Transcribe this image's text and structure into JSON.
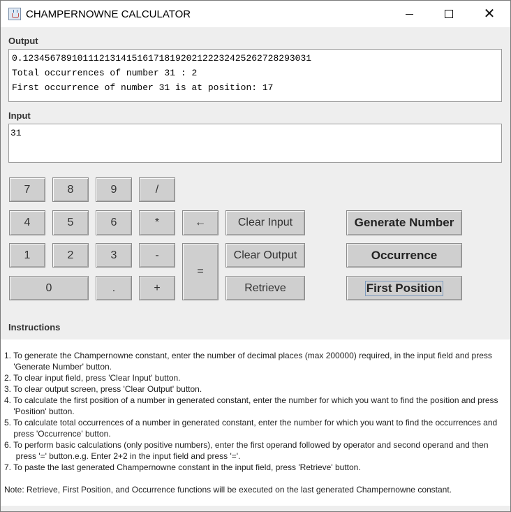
{
  "window": {
    "title": "CHAMPERNOWNE CALCULATOR",
    "close_glyph": "✕"
  },
  "output": {
    "label": "Output",
    "lines": [
      "0.12345678910111213141516171819202122232425262728293031",
      "Total occurrences of number 31 : 2",
      "First occurrence of number 31 is at position: 17"
    ]
  },
  "input": {
    "label": "Input",
    "value": "31"
  },
  "keypad": {
    "k7": "7",
    "k8": "8",
    "k9": "9",
    "div": "/",
    "k4": "4",
    "k5": "5",
    "k6": "6",
    "mul": "*",
    "back": "←",
    "k1": "1",
    "k2": "2",
    "k3": "3",
    "sub": "-",
    "eq": "=",
    "k0": "0",
    "dot": ".",
    "add": "+"
  },
  "actions": {
    "clear_input": "Clear Input",
    "clear_output": "Clear Output",
    "retrieve": "Retrieve",
    "generate_number": "Generate Number",
    "occurrence": "Occurrence",
    "first_position": "First Position"
  },
  "instructions": {
    "heading": "Instructions",
    "lines": [
      "1. To generate the Champernowne constant, enter the number of decimal places (max 200000) required, in the input field and press",
      "    'Generate Number' button.",
      "2. To clear input field, press 'Clear Input' button.",
      "3. To clear output screen, press 'Clear Output' button.",
      "4. To calculate the first position of a number in generated constant, enter the number for which you want to find the position and press",
      "    'Position' button.",
      "5. To calculate total occurrences of a number in generated constant,  enter the number for which you want to find the occurrences and",
      "    press 'Occurrence' button.",
      "6. To perform basic calculations (only positive numbers), enter the first operand followed by operator and second operand and then",
      "     press '=' button.e.g. Enter 2+2 in the input field and press '='.",
      "7. To paste the last generated Champernowne constant in the input field, press 'Retrieve' button."
    ],
    "note": "Note: Retrieve, First Position, and Occurrence functions will be executed on the last generated Champernowne constant."
  }
}
